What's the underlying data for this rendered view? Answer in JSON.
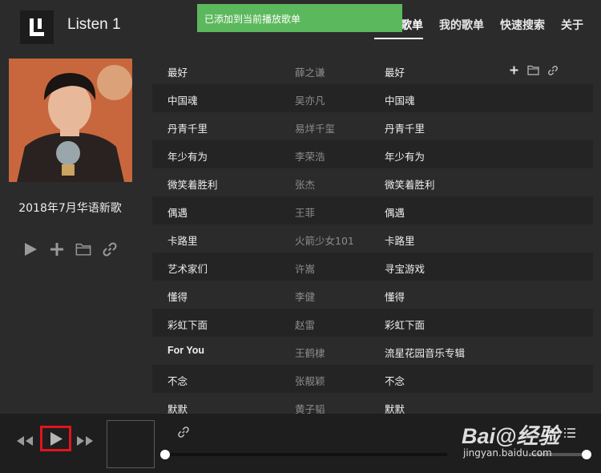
{
  "app": {
    "title": "Listen 1"
  },
  "toast": {
    "message": "已添加到当前播放歌单"
  },
  "nav": [
    {
      "label": "歌单"
    },
    {
      "label": "我的歌单"
    },
    {
      "label": "快速搜索"
    },
    {
      "label": "关于"
    }
  ],
  "playlist": {
    "title": "2018年7月华语新歌"
  },
  "songs": [
    {
      "title": "最好",
      "artist": "薛之谦",
      "album": "最好"
    },
    {
      "title": "中国魂",
      "artist": "吴亦凡",
      "album": "中国魂"
    },
    {
      "title": "丹青千里",
      "artist": "易烊千玺",
      "album": "丹青千里"
    },
    {
      "title": "年少有为",
      "artist": "李荣浩",
      "album": "年少有为"
    },
    {
      "title": "微笑着胜利",
      "artist": "张杰",
      "album": "微笑着胜利"
    },
    {
      "title": "偶遇",
      "artist": "王菲",
      "album": "偶遇"
    },
    {
      "title": "卡路里",
      "artist": "火箭少女101",
      "album": "卡路里"
    },
    {
      "title": "艺术家们",
      "artist": "许嵩",
      "album": "寻宝游戏"
    },
    {
      "title": "懂得",
      "artist": "李健",
      "album": "懂得"
    },
    {
      "title": "彩虹下面",
      "artist": "赵雷",
      "album": "彩虹下面"
    },
    {
      "title": "For You",
      "artist": "王鹤棣",
      "album": "流星花园音乐专辑"
    },
    {
      "title": "不念",
      "artist": "张靓颖",
      "album": "不念"
    },
    {
      "title": "默默",
      "artist": "黄子韬",
      "album": "默默"
    }
  ],
  "player": {
    "progress": 0,
    "volume": 1.0
  },
  "watermark": {
    "main": "Bai@经验",
    "sub": "jingyan.baidu.com"
  },
  "colors": {
    "toast": "#5cb85c",
    "highlight": "#e3141c",
    "cover_bg": "#c8673d"
  }
}
